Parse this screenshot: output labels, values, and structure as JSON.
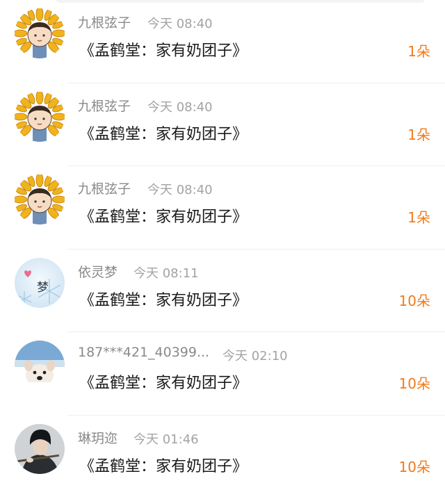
{
  "colors": {
    "name": "#8a8a8a",
    "time": "#a3a3a3",
    "gift": "#1a1a1a",
    "count": "#f07a1a",
    "divider": "#eeeeee"
  },
  "rows": [
    {
      "name": "九根弦子",
      "time": "今天 08:40",
      "gift": "《孟鹤堂：家有奶团子》",
      "count": "1朵",
      "avatar": "sunflower-avatar-icon"
    },
    {
      "name": "九根弦子",
      "time": "今天 08:40",
      "gift": "《孟鹤堂：家有奶团子》",
      "count": "1朵",
      "avatar": "sunflower-avatar-icon"
    },
    {
      "name": "九根弦子",
      "time": "今天 08:40",
      "gift": "《孟鹤堂：家有奶团子》",
      "count": "1朵",
      "avatar": "sunflower-avatar-icon"
    },
    {
      "name": "依灵梦",
      "time": "今天 08:11",
      "gift": "《孟鹤堂：家有奶团子》",
      "count": "10朵",
      "avatar": "snowflake-dream-avatar-icon",
      "avatar_text": "梦"
    },
    {
      "name": "187***421_40399...",
      "time": "今天 02:10",
      "gift": "《孟鹤堂：家有奶团子》",
      "count": "10朵",
      "avatar": "dog-avatar-icon"
    },
    {
      "name": "琳玥迩",
      "time": "今天 01:46",
      "gift": "《孟鹤堂：家有奶团子》",
      "count": "10朵",
      "avatar": "flute-player-avatar-icon"
    }
  ]
}
